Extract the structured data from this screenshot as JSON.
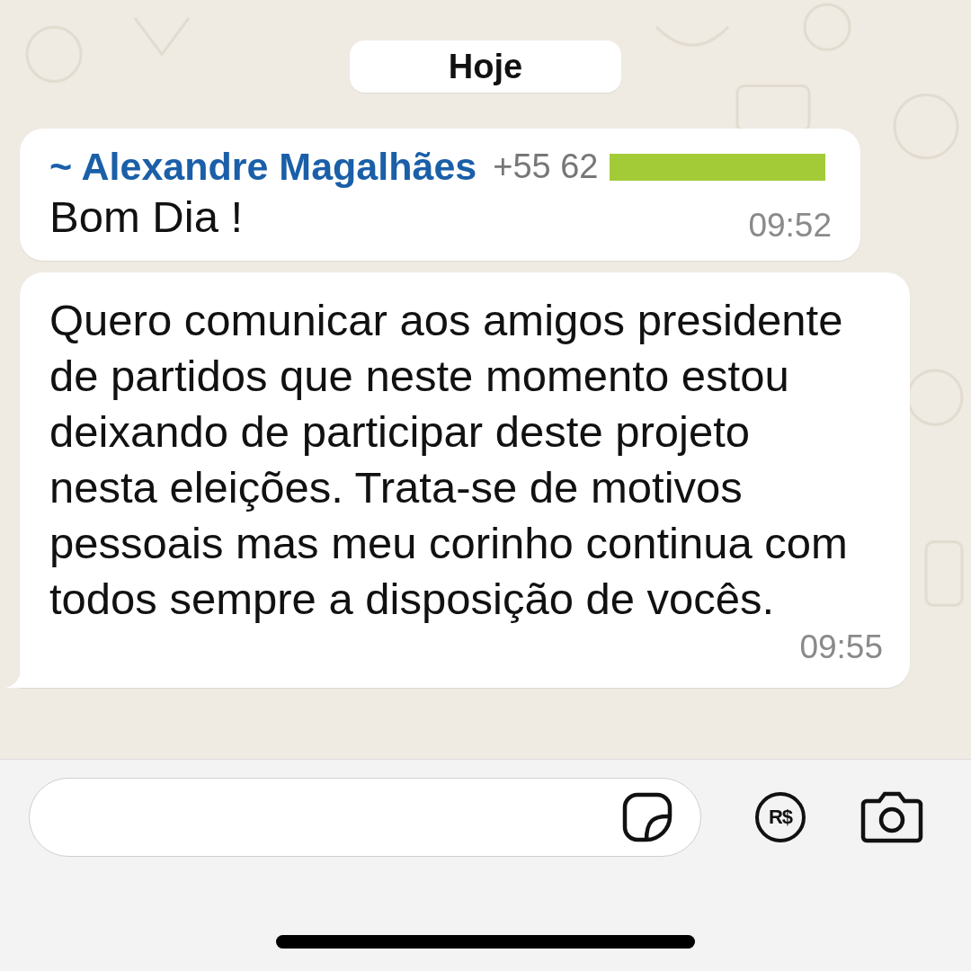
{
  "date_separator": "Hoje",
  "messages": [
    {
      "kind": "named",
      "sender_prefix": "~",
      "sender": "Alexandre Magalhães",
      "phone": "+55 62",
      "phone_redacted": true,
      "text": "Bom Dia !",
      "time": "09:52",
      "tail": false
    },
    {
      "kind": "plain",
      "text": "Quero comunicar aos amigos presidente de partidos que neste momento estou deixando de participar deste projeto nesta eleições. Trata-se de motivos pessoais mas meu corinho continua com todos sempre a disposição de vocês.",
      "time": "09:55",
      "tail": true
    }
  ],
  "composer": {
    "payment_label": "R$"
  }
}
